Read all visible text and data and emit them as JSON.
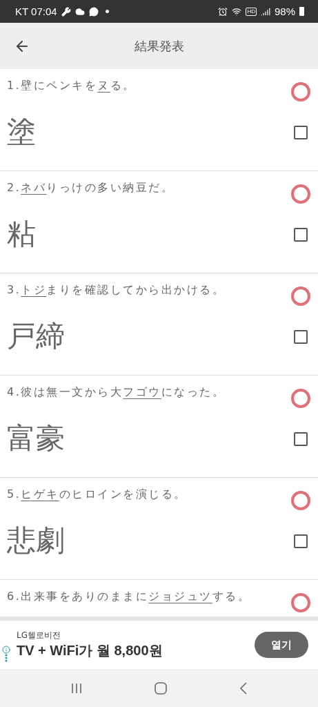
{
  "status_bar": {
    "carrier_time": "KT 07:04",
    "hd": "HD",
    "battery": "98%"
  },
  "header": {
    "title": "結果発表"
  },
  "questions": [
    {
      "number": "1.",
      "before": "壁にペンキを",
      "underlined": "ヌ",
      "after": "る。",
      "answer": "塗",
      "correct": true,
      "checked": false
    },
    {
      "number": "2.",
      "underlined": "ネバ",
      "after": "りっけの多い納豆だ。",
      "answer": "粘",
      "correct": true,
      "checked": false
    },
    {
      "number": "3.",
      "underlined": "トジ",
      "after": "まりを確認してから出かける。",
      "answer": "戸締",
      "correct": true,
      "checked": false
    },
    {
      "number": "4.",
      "before": "彼は無一文から大",
      "underlined": "フゴウ",
      "after": "になった。",
      "answer": "富豪",
      "correct": true,
      "checked": false
    },
    {
      "number": "5.",
      "underlined": "ヒゲキ",
      "after": "のヒロインを演じる。",
      "answer": "悲劇",
      "correct": true,
      "checked": false
    },
    {
      "number": "6.",
      "before": "出来事をありのままに",
      "underlined": "ジョジュツ",
      "after": "する。",
      "correct": true
    }
  ],
  "ad": {
    "advertiser": "LG헬로비전",
    "headline": "TV + WiFi가 월 8,800원",
    "button": "열기"
  }
}
